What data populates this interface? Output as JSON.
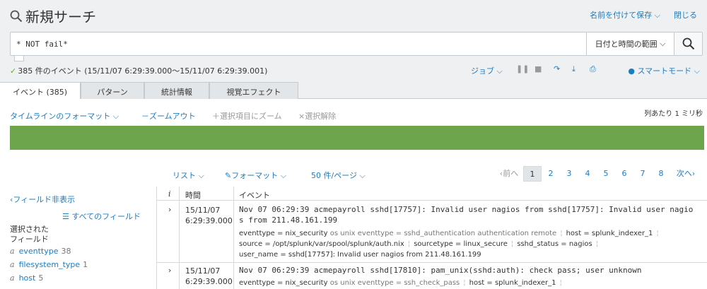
{
  "header": {
    "title": "新規サーチ",
    "save_as": "名前を付けて保存",
    "close": "閉じる"
  },
  "search": {
    "query": "* NOT fail*",
    "time_range": "日付と時間の範囲"
  },
  "status": {
    "summary": "385 件のイベント (15/11/07 6:29:39.000〜15/11/07 6:29:39.001)",
    "job": "ジョブ",
    "smart_mode": "スマートモード"
  },
  "tabs": [
    "イベント (385)",
    "パターン",
    "統計情報",
    "視覚エフェクト"
  ],
  "timeline": {
    "format": "タイムラインのフォーマット",
    "zoom_out": "－ズームアウト",
    "zoom_selection": "＋選択項目にズーム",
    "deselect": "×選択解除",
    "scale": "列あたり 1 ミリ秒"
  },
  "results": {
    "list": "リスト",
    "format": "フォーマット",
    "per_page": "50 件/ページ",
    "prev": "‹前へ",
    "pages": [
      "1",
      "2",
      "3",
      "4",
      "5",
      "6",
      "7",
      "8"
    ],
    "current_page": "1",
    "next": "次へ›"
  },
  "sidebar": {
    "hide_fields": "フィールド非表示",
    "all_fields": "すべてのフィールド",
    "selected_heading": "選択された\nフィールド",
    "fields": [
      {
        "type": "a",
        "name": "eventtype",
        "count": "38"
      },
      {
        "type": "a",
        "name": "filesystem_type",
        "count": "1"
      },
      {
        "type": "a",
        "name": "host",
        "count": "5"
      }
    ]
  },
  "table": {
    "col_info": "i",
    "col_time": "時間",
    "col_event": "イベント",
    "events": [
      {
        "date": "15/11/07",
        "time": "6:29:39.000",
        "raw_line1": "Nov 07 06:29:39 acmepayroll sshd[17757]: Invalid user nagios from sshd[17757]: Invalid user nagio",
        "raw_line2": "s from 211.48.161.199",
        "f1": "eventtype = nix_security",
        "f1b": "os unix eventtype = sshd_authentication",
        "f1c": "authentication remote",
        "f1d": "host = splunk_indexer_1",
        "f2a": "source = /opt/splunk/var/spool/splunk/auth.nix",
        "f2b": "sourcetype = linux_secure",
        "f2c": "sshd_status = nagios",
        "f3": "user_name = sshd[17757]: Invalid user nagios from 211.48.161.199"
      },
      {
        "date": "15/11/07",
        "time": "6:29:39.000",
        "raw_line1": "Nov 07 06:29:39 acmepayroll sshd[17810]: pam_unix(sshd:auth): check pass; user unknown",
        "f1": "eventtype = nix_security",
        "f1b": "os unix eventtype = ssh_check_pass",
        "f1d": "host = splunk_indexer_1"
      }
    ]
  },
  "colors": {
    "accent": "#1a7dc4",
    "timeline": "#6ca54b",
    "check": "#65a637"
  }
}
